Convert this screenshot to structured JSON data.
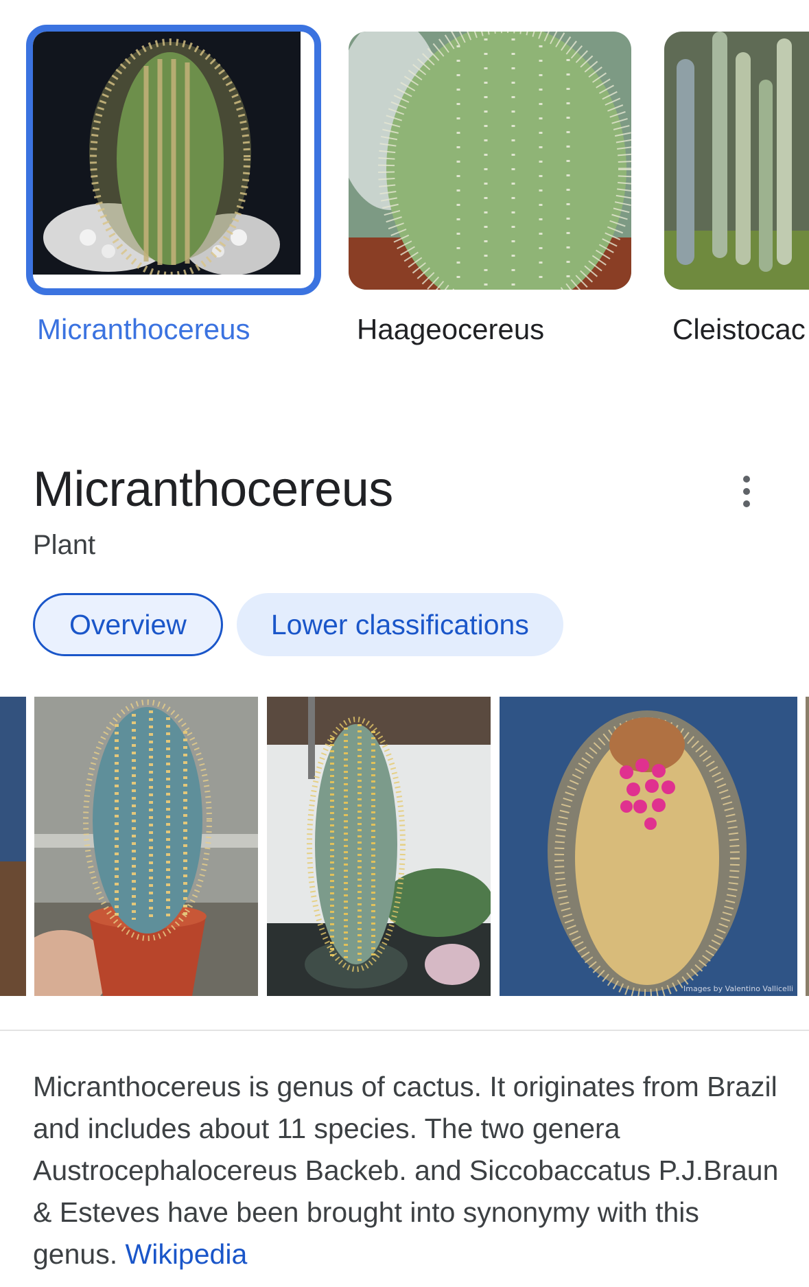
{
  "related": {
    "items": [
      {
        "label": "Micranthocereus",
        "selected": true
      },
      {
        "label": "Haageocereus",
        "selected": false
      },
      {
        "label": "Cleistocac",
        "selected": false
      }
    ]
  },
  "entity": {
    "title": "Micranthocereus",
    "subtitle": "Plant",
    "more_icon": "more-vert-icon"
  },
  "tabs": [
    {
      "label": "Overview",
      "active": true
    },
    {
      "label": "Lower classifications",
      "active": false
    }
  ],
  "gallery": {
    "watermark": "Images by Valentino Vallicelli"
  },
  "description": {
    "text": "Micranthocereus is genus of cactus. It originates from Brazil and includes about 11 species. The two genera Austrocephalocereus Backeb. and Siccobaccatus P.J.Braun & Esteves have been brought into synonymy with this genus.",
    "source_link": "Wikipedia"
  },
  "colors": {
    "accent": "#3b73e0",
    "link": "#1a56c9",
    "tab_bg": "#e3edfd",
    "text": "#202124"
  }
}
